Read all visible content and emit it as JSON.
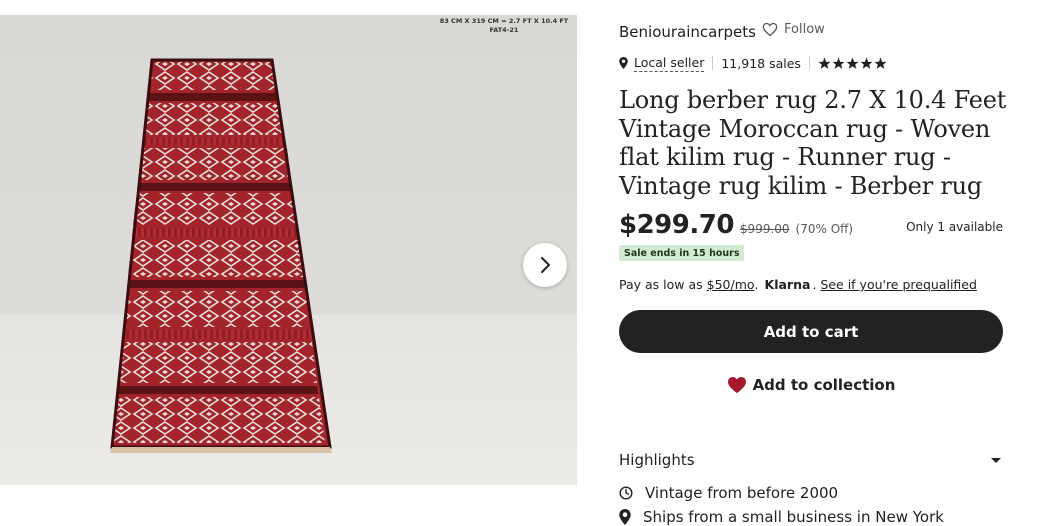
{
  "photo": {
    "caption_line1": "83 CM X 319 CM = 2.7 FT X 10.4 FT",
    "caption_line2": "FAT4-21",
    "next_icon": "chevron-right-icon"
  },
  "shop": {
    "name": "Beniouraincarpets",
    "follow_label": "Follow",
    "location_icon": "map-pin-icon",
    "local_seller": "Local seller",
    "sales": "11,918 sales",
    "rating_stars": 5
  },
  "listing": {
    "title": "Long berber rug 2.7 X 10.4 Feet Vintage Moroccan rug - Woven flat kilim rug - Runner rug - Vintage rug kilim - Berber rug",
    "price": "$299.70",
    "original_price": "$999.00",
    "discount": "(70% Off)",
    "availability": "Only 1 available",
    "sale_badge": "Sale ends in 15 hours"
  },
  "klarna": {
    "prefix": "Pay as low as",
    "amount": "$50/mo",
    "period": ".",
    "brand": "Klarna",
    "dot": ".",
    "link": "See if you're prequalified"
  },
  "actions": {
    "add_to_cart": "Add to cart",
    "add_to_collection": "Add to collection"
  },
  "highlights": {
    "label": "Highlights",
    "items": [
      {
        "icon": "vintage-icon",
        "text": "Vintage from before 2000"
      },
      {
        "icon": "map-pin-icon",
        "text": "Ships from a small business in New York"
      }
    ]
  },
  "colors": {
    "accent_dark": "#222222",
    "heart_red": "#a61a2e",
    "sale_green": "#d4e9d1"
  }
}
